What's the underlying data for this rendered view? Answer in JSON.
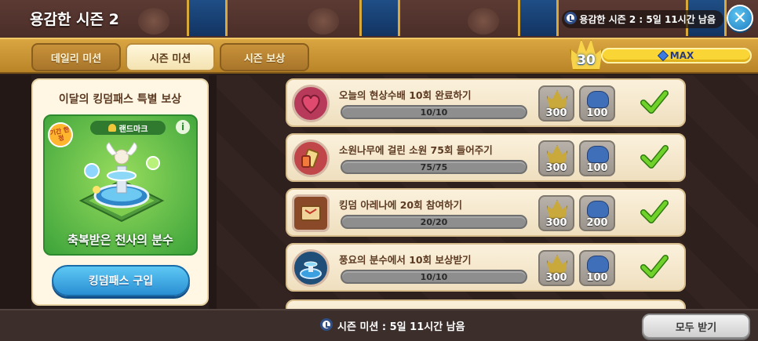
{
  "header": {
    "title": "용감한 시즌 2",
    "season_remaining": "용감한 시즌 2 : 5일 11시간 남음",
    "close_icon": "close-icon"
  },
  "tabs": [
    {
      "label": "데일리 미션",
      "active": false
    },
    {
      "label": "시즌 미션",
      "active": true
    },
    {
      "label": "시즌 보상",
      "active": false
    }
  ],
  "level": {
    "value": "30",
    "bar_label": "MAX",
    "progress_fraction": 1.0
  },
  "pass_panel": {
    "title": "이달의 킹덤패스 특별 보상",
    "tag": "랜드마크",
    "limited_badge": "기간 한정",
    "item_name": "축복받은 천사의 분수",
    "buy_button": "킹덤패스 구입"
  },
  "missions": [
    {
      "title": "오늘의 현상수배 10회 완료하기",
      "progress": "10/10",
      "reward_crown": "300",
      "reward_cloud": "100",
      "icon": "heart-cookie-icon",
      "completed": true
    },
    {
      "title": "소원나무에 걸린 소원 75회 들어주기",
      "progress": "75/75",
      "reward_crown": "300",
      "reward_cloud": "100",
      "icon": "wish-scroll-icon",
      "completed": true
    },
    {
      "title": "킹덤 아레나에 20회 참여하기",
      "progress": "20/20",
      "reward_crown": "300",
      "reward_cloud": "200",
      "icon": "arena-map-icon",
      "completed": true
    },
    {
      "title": "풍요의 분수에서 10회 보상받기",
      "progress": "10/10",
      "reward_crown": "300",
      "reward_cloud": "100",
      "icon": "fountain-icon",
      "completed": true
    }
  ],
  "footer": {
    "mission_remaining": "시즌 미션 : 5일 11시간 남음",
    "claim_all": "모두 받기"
  },
  "colors": {
    "tab_bar": "#d9a642",
    "accent_blue": "#2a8fd3",
    "xp_yellow": "#f9d536",
    "check_green": "#5cc21a"
  }
}
